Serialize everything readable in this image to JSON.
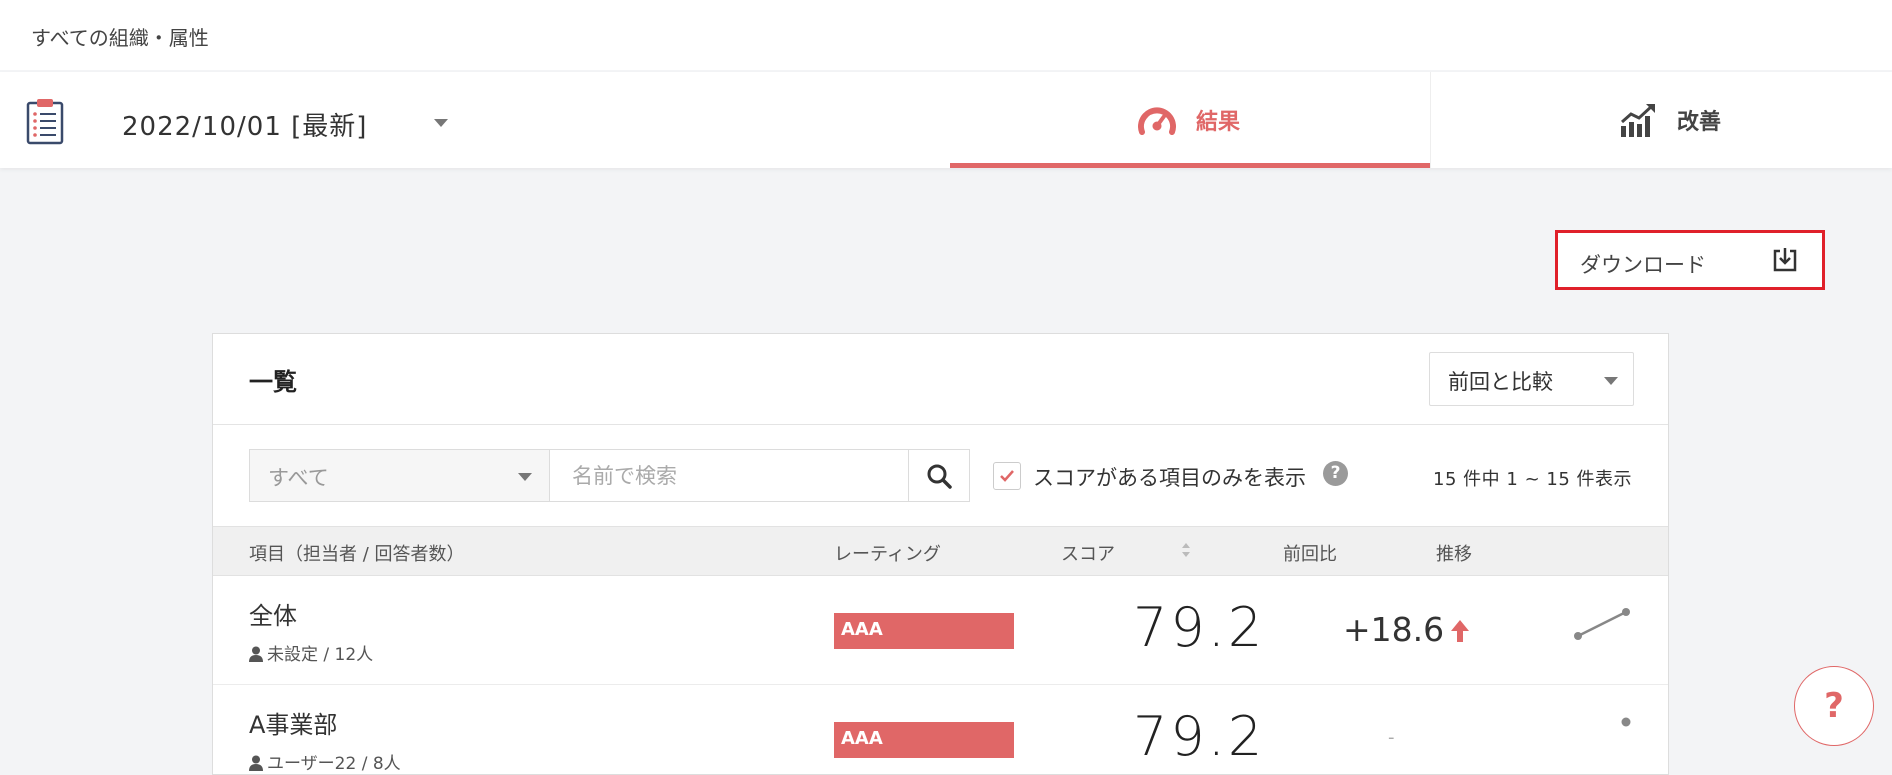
{
  "breadcrumb": "すべての組織・属性",
  "header": {
    "date_select": "2022/10/01 [最新]",
    "tabs": [
      {
        "label": "結果",
        "active": true
      },
      {
        "label": "改善",
        "active": false
      }
    ]
  },
  "download_button": "ダウンロード",
  "colors": {
    "accent": "#e06767",
    "highlight_border": "#e0202a"
  },
  "list": {
    "title": "一覧",
    "compare_select": "前回と比較",
    "filter": {
      "category_select": "すべて",
      "search_placeholder": "名前で検索",
      "checkbox_label": "スコアがある項目のみを表示",
      "checkbox_checked": true,
      "count_text": "15 件中 1 ~ 15 件表示"
    },
    "columns": [
      "項目（担当者 / 回答者数）",
      "レーティング",
      "スコア",
      "前回比",
      "推移"
    ],
    "rows": [
      {
        "name": "全体",
        "meta": "未設定 / 12人",
        "rating": "AAA",
        "score": "79.2",
        "diff": "+18.6",
        "diff_direction": "up",
        "trend": "line"
      },
      {
        "name": "A事業部",
        "meta": "ユーザー22 / 8人",
        "rating": "AAA",
        "score": "79.2",
        "diff": "-",
        "diff_direction": "none",
        "trend": "point"
      }
    ]
  },
  "help_fab": "?"
}
